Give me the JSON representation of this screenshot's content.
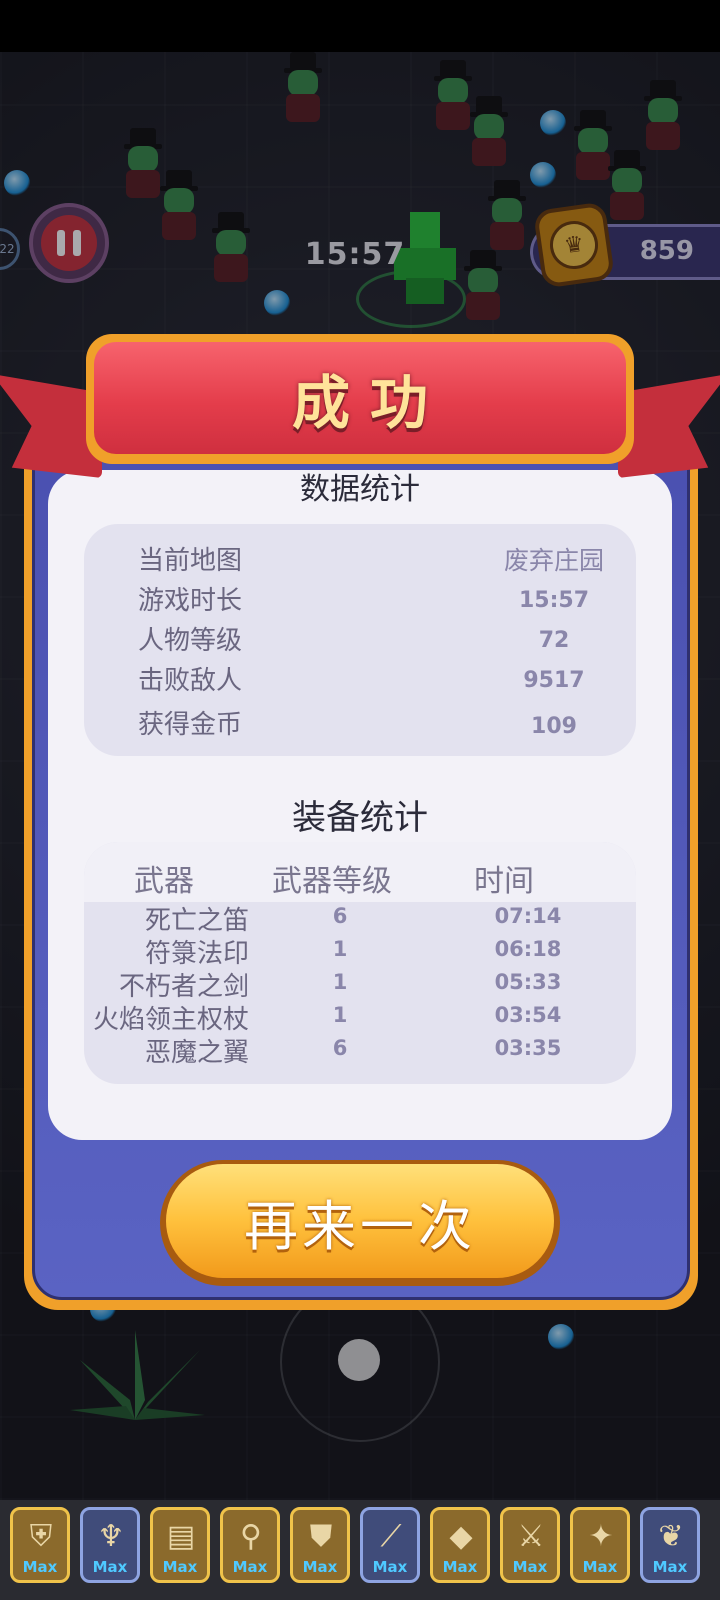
{
  "hud": {
    "timer": "15:57",
    "coins": "859",
    "level_indicator": "22"
  },
  "result": {
    "title": "成功",
    "stats_title": "数据统计",
    "stats": [
      {
        "label": "当前地图",
        "value": "废弃庄园"
      },
      {
        "label": "游戏时长",
        "value": "15:57"
      },
      {
        "label": "人物等级",
        "value": "72"
      },
      {
        "label": "击败敌人",
        "value": "9517"
      },
      {
        "label": "获得金币",
        "value": "109"
      }
    ],
    "equipment_title": "装备统计",
    "equipment_headers": {
      "weapon": "武器",
      "level": "武器等级",
      "time": "时间"
    },
    "equipment": [
      {
        "name": "死亡之笛",
        "level": "6",
        "time": "07:14"
      },
      {
        "name": "符箓法印",
        "level": "1",
        "time": "06:18"
      },
      {
        "name": "不朽者之剑",
        "level": "1",
        "time": "05:33"
      },
      {
        "name": "火焰领主权杖",
        "level": "1",
        "time": "03:54"
      },
      {
        "name": "恶魔之翼",
        "level": "6",
        "time": "03:35"
      }
    ],
    "retry_button": "再来一次"
  },
  "skills": [
    {
      "icon": "shield-icon",
      "glyph": "⛨",
      "style": "gold",
      "label": "Max"
    },
    {
      "icon": "bat-wing-icon",
      "glyph": "♆",
      "style": "blue",
      "label": "Max"
    },
    {
      "icon": "scroll-icon",
      "glyph": "▤",
      "style": "gold",
      "label": "Max"
    },
    {
      "icon": "magnifier-icon",
      "glyph": "⚲",
      "style": "gold",
      "label": "Max"
    },
    {
      "icon": "armor-icon",
      "glyph": "⛊",
      "style": "gold",
      "label": "Max"
    },
    {
      "icon": "flute-icon",
      "glyph": "⟋",
      "style": "blue",
      "label": "Max"
    },
    {
      "icon": "talisman-icon",
      "glyph": "◆",
      "style": "gold",
      "label": "Max"
    },
    {
      "icon": "sword-icon",
      "glyph": "⚔",
      "style": "gold",
      "label": "Max"
    },
    {
      "icon": "fire-scepter-icon",
      "glyph": "✦",
      "style": "gold",
      "label": "Max"
    },
    {
      "icon": "demon-wings-icon",
      "glyph": "❦",
      "style": "blue",
      "label": "Max"
    }
  ],
  "colors": {
    "ribbon": "#e43d4b",
    "panel": "#5a63c3",
    "button": "#ffc23e",
    "stat_value": "#8a86aa"
  }
}
